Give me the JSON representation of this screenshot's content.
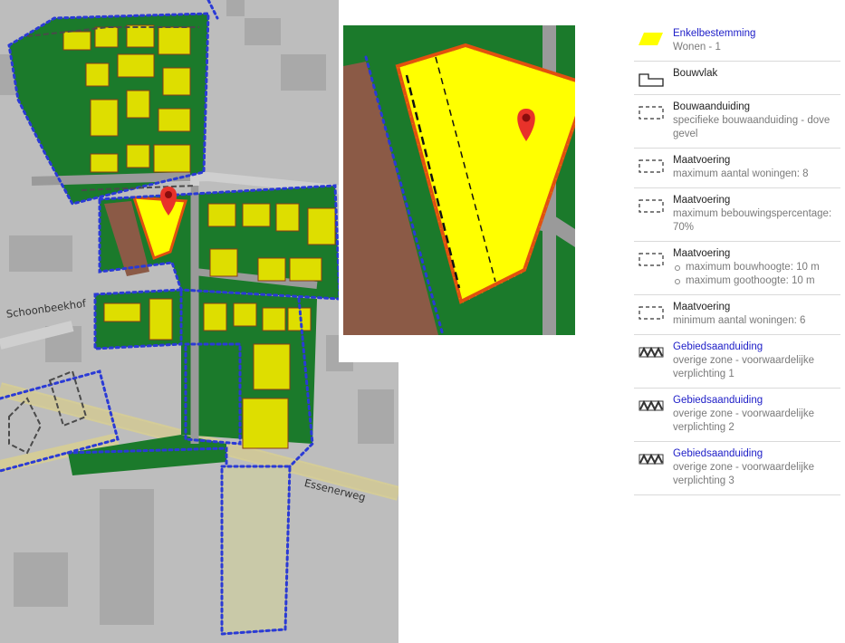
{
  "map": {
    "street_labels": {
      "schoonbeekhof": "Schoonbeekhof",
      "essenerweg": "Essenerweg"
    },
    "marker_icon": "map-pin-icon",
    "colors": {
      "background": "#bdbdbd",
      "green_zone": "#1b7a2b",
      "residential": "#e6e600",
      "selection": "#ffff00",
      "selection_border": "#e2500f",
      "boundary": "#2a3ad6",
      "brown_plot": "#8b5a46",
      "marker": "#e8322a"
    }
  },
  "legend": {
    "items": [
      {
        "title": "Enkelbestemming",
        "title_is_link": true,
        "lines": [
          "Wonen - 1"
        ],
        "symbol": "yellow-parallelogram-icon"
      },
      {
        "title": "Bouwvlak",
        "title_is_link": false,
        "lines": [],
        "symbol": "building-outline-icon"
      },
      {
        "title": "Bouwaanduiding",
        "title_is_link": false,
        "lines": [
          "specifieke bouwaanduiding - dove gevel"
        ],
        "symbol": "dashed-box-icon"
      },
      {
        "title": "Maatvoering",
        "title_is_link": false,
        "lines": [
          "maximum aantal woningen: 8"
        ],
        "symbol": "dashed-box-icon"
      },
      {
        "title": "Maatvoering",
        "title_is_link": false,
        "lines": [
          "maximum bebouwingspercentage: 70%"
        ],
        "symbol": "dashed-box-icon"
      },
      {
        "title": "Maatvoering",
        "title_is_link": false,
        "bullets": [
          "maximum bouwhoogte: 10 m",
          "maximum goothoogte: 10 m"
        ],
        "symbol": "dashed-box-icon"
      },
      {
        "title": "Maatvoering",
        "title_is_link": false,
        "lines": [
          "minimum aantal woningen: 6"
        ],
        "symbol": "dashed-box-icon"
      },
      {
        "title": "Gebiedsaanduiding",
        "title_is_link": true,
        "lines": [
          "overige zone - voorwaardelijke verplichting 1"
        ],
        "symbol": "zigzag-zone-icon"
      },
      {
        "title": "Gebiedsaanduiding",
        "title_is_link": true,
        "lines": [
          "overige zone - voorwaardelijke verplichting 2"
        ],
        "symbol": "zigzag-zone-icon"
      },
      {
        "title": "Gebiedsaanduiding",
        "title_is_link": true,
        "lines": [
          "overige zone - voorwaardelijke verplichting 3"
        ],
        "symbol": "zigzag-zone-icon"
      }
    ]
  }
}
